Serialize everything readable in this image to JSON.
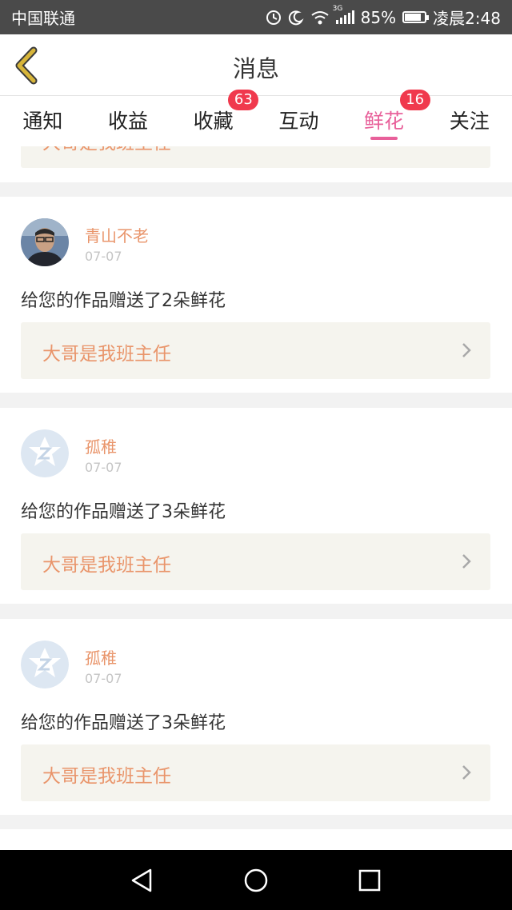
{
  "status_bar": {
    "carrier": "中国联通",
    "network": "3G",
    "battery_percent": "85%",
    "battery_level": 0.85,
    "time": "凌晨2:48",
    "icons": [
      "data-saver-icon",
      "moon-icon",
      "wifi-icon",
      "signal-icon",
      "battery-icon"
    ]
  },
  "header": {
    "title": "消息",
    "back_icon": "chevron-left-icon",
    "accent_color": "#c9a227"
  },
  "tabs": [
    {
      "label": "通知",
      "badge": ""
    },
    {
      "label": "收益",
      "badge": ""
    },
    {
      "label": "收藏",
      "badge": "63"
    },
    {
      "label": "互动",
      "badge": ""
    },
    {
      "label": "鲜花",
      "badge": "16",
      "active": true
    },
    {
      "label": "关注",
      "badge": ""
    }
  ],
  "active_color": "#e8609a",
  "badge_color": "#f0394d",
  "feed": {
    "partial_card": {
      "work_title": "大哥是我班主任"
    },
    "items": [
      {
        "username": "青山不老",
        "date": "07-07",
        "message": "给您的作品赠送了2朵鲜花",
        "work_title": "大哥是我班主任",
        "avatar": "photo-avatar"
      },
      {
        "username": "孤稚",
        "date": "07-07",
        "message": "给您的作品赠送了3朵鲜花",
        "work_title": "大哥是我班主任",
        "avatar": "default-avatar-icon"
      },
      {
        "username": "孤稚",
        "date": "07-07",
        "message": "给您的作品赠送了3朵鲜花",
        "work_title": "大哥是我班主任",
        "avatar": "default-avatar-icon"
      }
    ]
  },
  "nav_bar": {
    "icons": [
      "back-triangle-icon",
      "home-circle-icon",
      "recents-square-icon"
    ]
  }
}
